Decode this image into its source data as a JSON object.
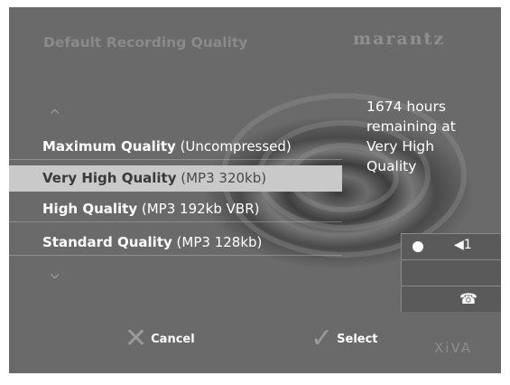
{
  "header": {
    "title": "Default Recording Quality",
    "brand": "marantz"
  },
  "menu": {
    "up_arrow": "^",
    "down_arrow": "^",
    "items": [
      {
        "quality": "Maximum Quality",
        "detail": " (Uncompressed)",
        "selected": false
      },
      {
        "quality": "Very High Quality",
        "detail": " (MP3 320kb)",
        "selected": true
      },
      {
        "quality": "High Quality",
        "detail": " (MP3 192kb VBR)",
        "selected": false
      },
      {
        "quality": "Standard Quality",
        "detail": " (MP3 128kb)",
        "selected": false
      }
    ]
  },
  "status": {
    "text": "1674 hours remaining at Very High Quality"
  },
  "panel": {
    "record_icon": "record-dot-icon",
    "volume_icon": "speaker-icon",
    "volume_label": "◀1",
    "phone_icon": "telephone-icon",
    "phone_symbol": "☎"
  },
  "footer": {
    "cancel_label": "Cancel",
    "cancel_symbol": "✕",
    "select_label": "Select",
    "select_symbol": "✓",
    "logo": "XiVA"
  }
}
